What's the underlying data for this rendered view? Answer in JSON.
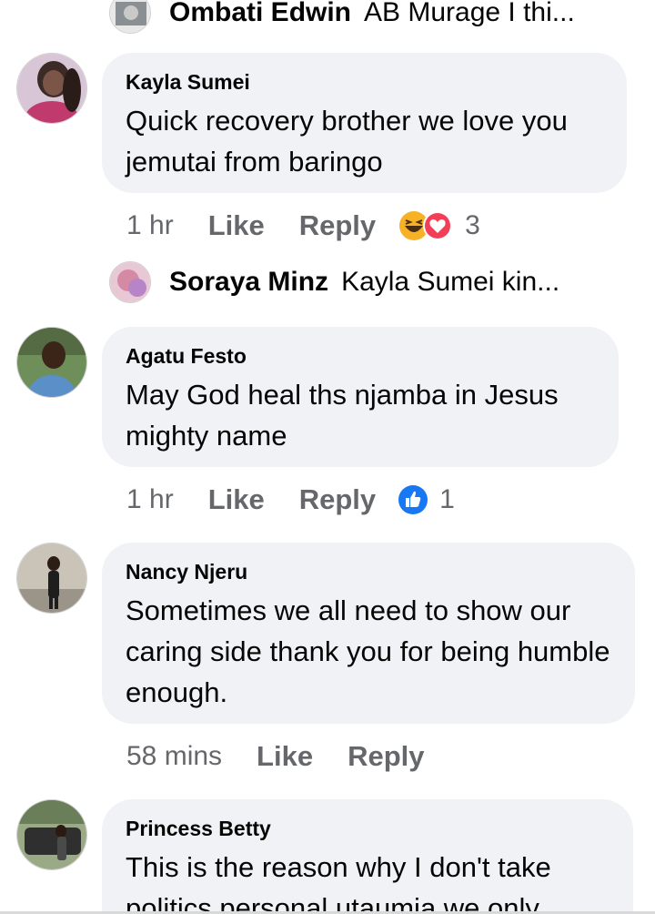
{
  "comments_thread": {
    "reply_preview_1": {
      "name": "Ombati Edwin",
      "preview": "AB Murage I thi..."
    },
    "comment_1": {
      "author": "Kayla Sumei",
      "text": "Quick recovery brother we love you jemutai from baringo",
      "time": "1 hr",
      "like_label": "Like",
      "reply_label": "Reply",
      "reactions": [
        "haha-icon",
        "love-icon"
      ],
      "reaction_count": "3",
      "colors": {
        "haha": "#f7b125",
        "love": "#f33e58"
      }
    },
    "reply_preview_2": {
      "name": "Soraya Minz",
      "preview": "Kayla Sumei  kin..."
    },
    "comment_2": {
      "author": "Agatu Festo",
      "text": "May God heal ths njamba in Jesus mighty name",
      "time": "1 hr",
      "like_label": "Like",
      "reply_label": "Reply",
      "reactions": [
        "like-icon"
      ],
      "reaction_count": "1",
      "colors": {
        "like": "#1877f2"
      }
    },
    "comment_3": {
      "author": "Nancy Njeru",
      "text": "Sometimes we all need to show our caring side thank you for being humble enough.",
      "time": "58 mins",
      "like_label": "Like",
      "reply_label": "Reply"
    },
    "comment_4": {
      "author": "Princess Betty",
      "text": "This is the reason why I don't take politics personal utaumia we only"
    }
  }
}
